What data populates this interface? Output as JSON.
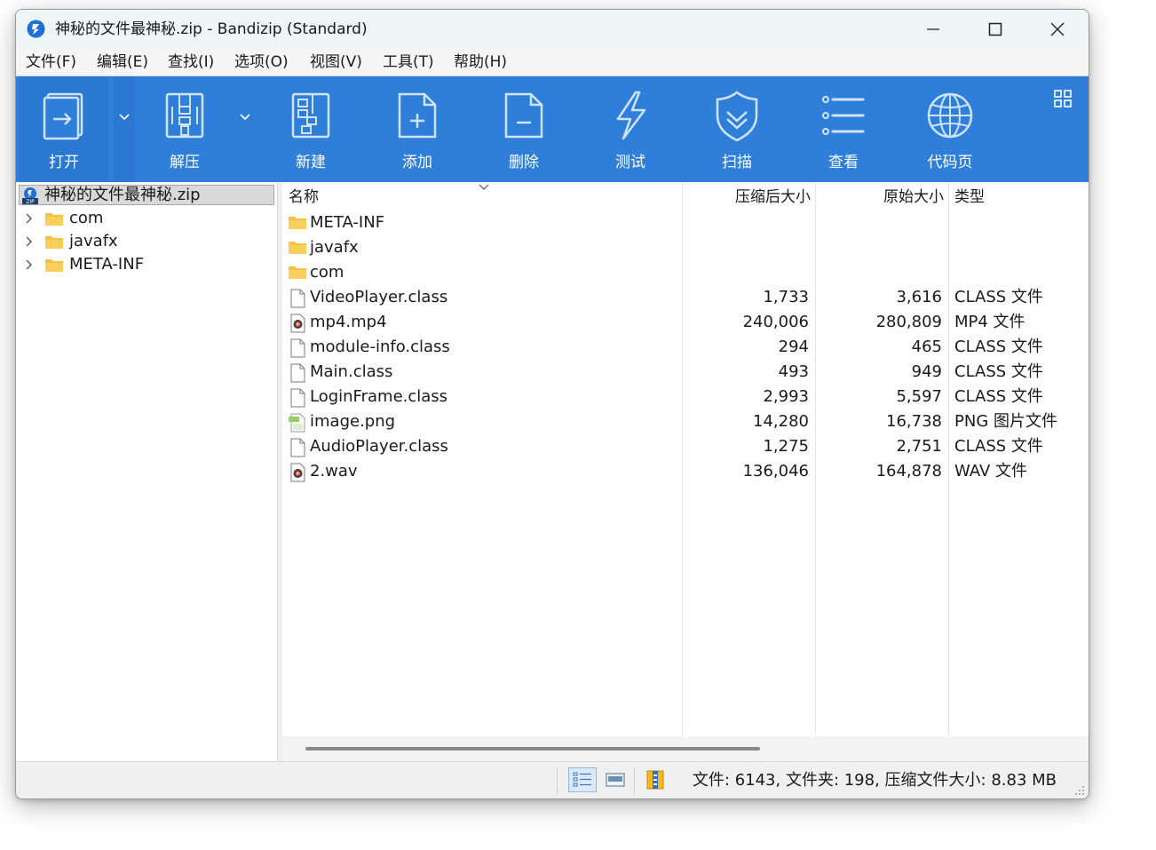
{
  "window": {
    "title": "神秘的文件最神秘.zip - Bandizip (Standard)"
  },
  "menu": [
    "文件(F)",
    "编辑(E)",
    "查找(I)",
    "选项(O)",
    "视图(V)",
    "工具(T)",
    "帮助(H)"
  ],
  "toolbar": {
    "open": "打开",
    "extract": "解压",
    "new": "新建",
    "add": "添加",
    "delete": "删除",
    "test": "测试",
    "scan": "扫描",
    "view": "查看",
    "codepage": "代码页"
  },
  "tree": {
    "root": "神秘的文件最神秘.zip",
    "children": [
      "com",
      "javafx",
      "META-INF"
    ]
  },
  "columns": {
    "name": "名称",
    "compressed": "压缩后大小",
    "original": "原始大小",
    "type": "类型"
  },
  "files": [
    {
      "name": "META-INF",
      "icon": "folder-icon",
      "compressed": "",
      "original": "",
      "type": ""
    },
    {
      "name": "javafx",
      "icon": "folder-icon",
      "compressed": "",
      "original": "",
      "type": ""
    },
    {
      "name": "com",
      "icon": "folder-icon",
      "compressed": "",
      "original": "",
      "type": ""
    },
    {
      "name": "VideoPlayer.class",
      "icon": "file-icon",
      "compressed": "1,733",
      "original": "3,616",
      "type": "CLASS 文件"
    },
    {
      "name": "mp4.mp4",
      "icon": "media-file-icon",
      "compressed": "240,006",
      "original": "280,809",
      "type": "MP4 文件"
    },
    {
      "name": "module-info.class",
      "icon": "file-icon",
      "compressed": "294",
      "original": "465",
      "type": "CLASS 文件"
    },
    {
      "name": "Main.class",
      "icon": "file-icon",
      "compressed": "493",
      "original": "949",
      "type": "CLASS 文件"
    },
    {
      "name": "LoginFrame.class",
      "icon": "file-icon",
      "compressed": "2,993",
      "original": "5,597",
      "type": "CLASS 文件"
    },
    {
      "name": "image.png",
      "icon": "image-file-icon",
      "compressed": "14,280",
      "original": "16,738",
      "type": "PNG 图片文件"
    },
    {
      "name": "AudioPlayer.class",
      "icon": "file-icon",
      "compressed": "1,275",
      "original": "2,751",
      "type": "CLASS 文件"
    },
    {
      "name": "2.wav",
      "icon": "media-file-icon",
      "compressed": "136,046",
      "original": "164,878",
      "type": "WAV 文件"
    }
  ],
  "status": {
    "summary": "文件: 6143, 文件夹: 198, 压缩文件大小: 8.83 MB"
  },
  "colors": {
    "toolbar_bg": "#2f7fda",
    "titlebar_bg": "#eef6f5",
    "folder": "#f5c342"
  }
}
